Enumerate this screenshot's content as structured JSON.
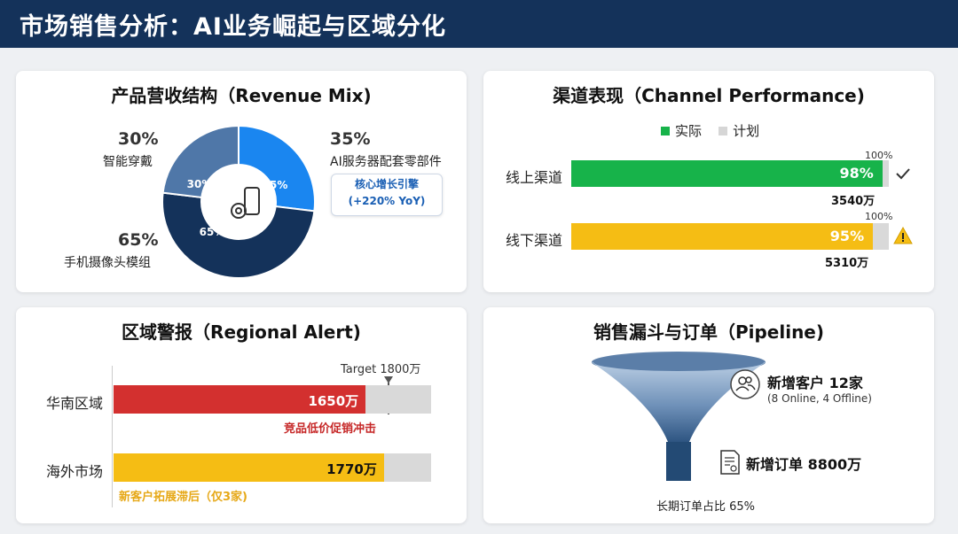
{
  "header": {
    "title": "市场销售分析：AI业务崛起与区域分化"
  },
  "revenue_mix": {
    "title": "产品营收结构（Revenue Mix)",
    "callout": [
      "核心增长引擎",
      "(+220% YoY)"
    ],
    "items": [
      {
        "pct": "35%",
        "label": "AI服务器配套零部件"
      },
      {
        "pct": "30%",
        "label": "智能穿戴"
      },
      {
        "pct": "65%",
        "label": "手机摄像头模组"
      }
    ],
    "colors": [
      "#1a86f0",
      "#4f77a8",
      "#14325a"
    ]
  },
  "channel": {
    "title": "渠道表现（Channel Performance)",
    "legend": {
      "actual": "实际",
      "plan": "计划"
    },
    "rows": [
      {
        "label": "线上渠道",
        "pct_label": "98%",
        "plan_label": "100%",
        "amount": "3540万",
        "status": "check",
        "color": "#17b34a"
      },
      {
        "label": "线下渠道",
        "pct_label": "95%",
        "plan_label": "100%",
        "amount": "5310万",
        "status": "warning",
        "color": "#f5bd14"
      }
    ]
  },
  "regional": {
    "title": "区域警报（Regional Alert)",
    "target_label": "Target 1800万",
    "rows": [
      {
        "label": "华南区域",
        "value_label": "1650万",
        "note": "竞品低价促销冲击",
        "color": "#d3302f"
      },
      {
        "label": "海外市场",
        "value_label": "1770万",
        "note": "新客户拓展滞后（仅3家)",
        "color": "#f5bd14"
      }
    ]
  },
  "pipeline": {
    "title": "销售漏斗与订单（Pipeline)",
    "customers_title": "新增客户 12家",
    "customers_sub": "(8 Online, 4 Offline)",
    "orders_title": "新增订单 8800万",
    "long_term": "长期订单占比 65%"
  },
  "chart_data": [
    {
      "type": "pie",
      "title": "产品营收结构（Revenue Mix)",
      "categories": [
        "AI服务器配套零部件",
        "手机摄像头模组",
        "智能穿戴"
      ],
      "values": [
        35,
        65,
        30
      ],
      "unit": "%"
    },
    {
      "type": "bar",
      "title": "渠道表现（Channel Performance)",
      "categories": [
        "线上渠道",
        "线下渠道"
      ],
      "series": [
        {
          "name": "实际",
          "values": [
            98,
            95
          ]
        },
        {
          "name": "计划",
          "values": [
            100,
            100
          ]
        }
      ],
      "annotations": [
        "3540万",
        "5310万"
      ],
      "ylim": [
        0,
        100
      ]
    },
    {
      "type": "bar",
      "title": "区域警报（Regional Alert)",
      "categories": [
        "华南区域",
        "海外市场"
      ],
      "values": [
        1650,
        1770
      ],
      "target": 1800,
      "unit": "万"
    }
  ]
}
